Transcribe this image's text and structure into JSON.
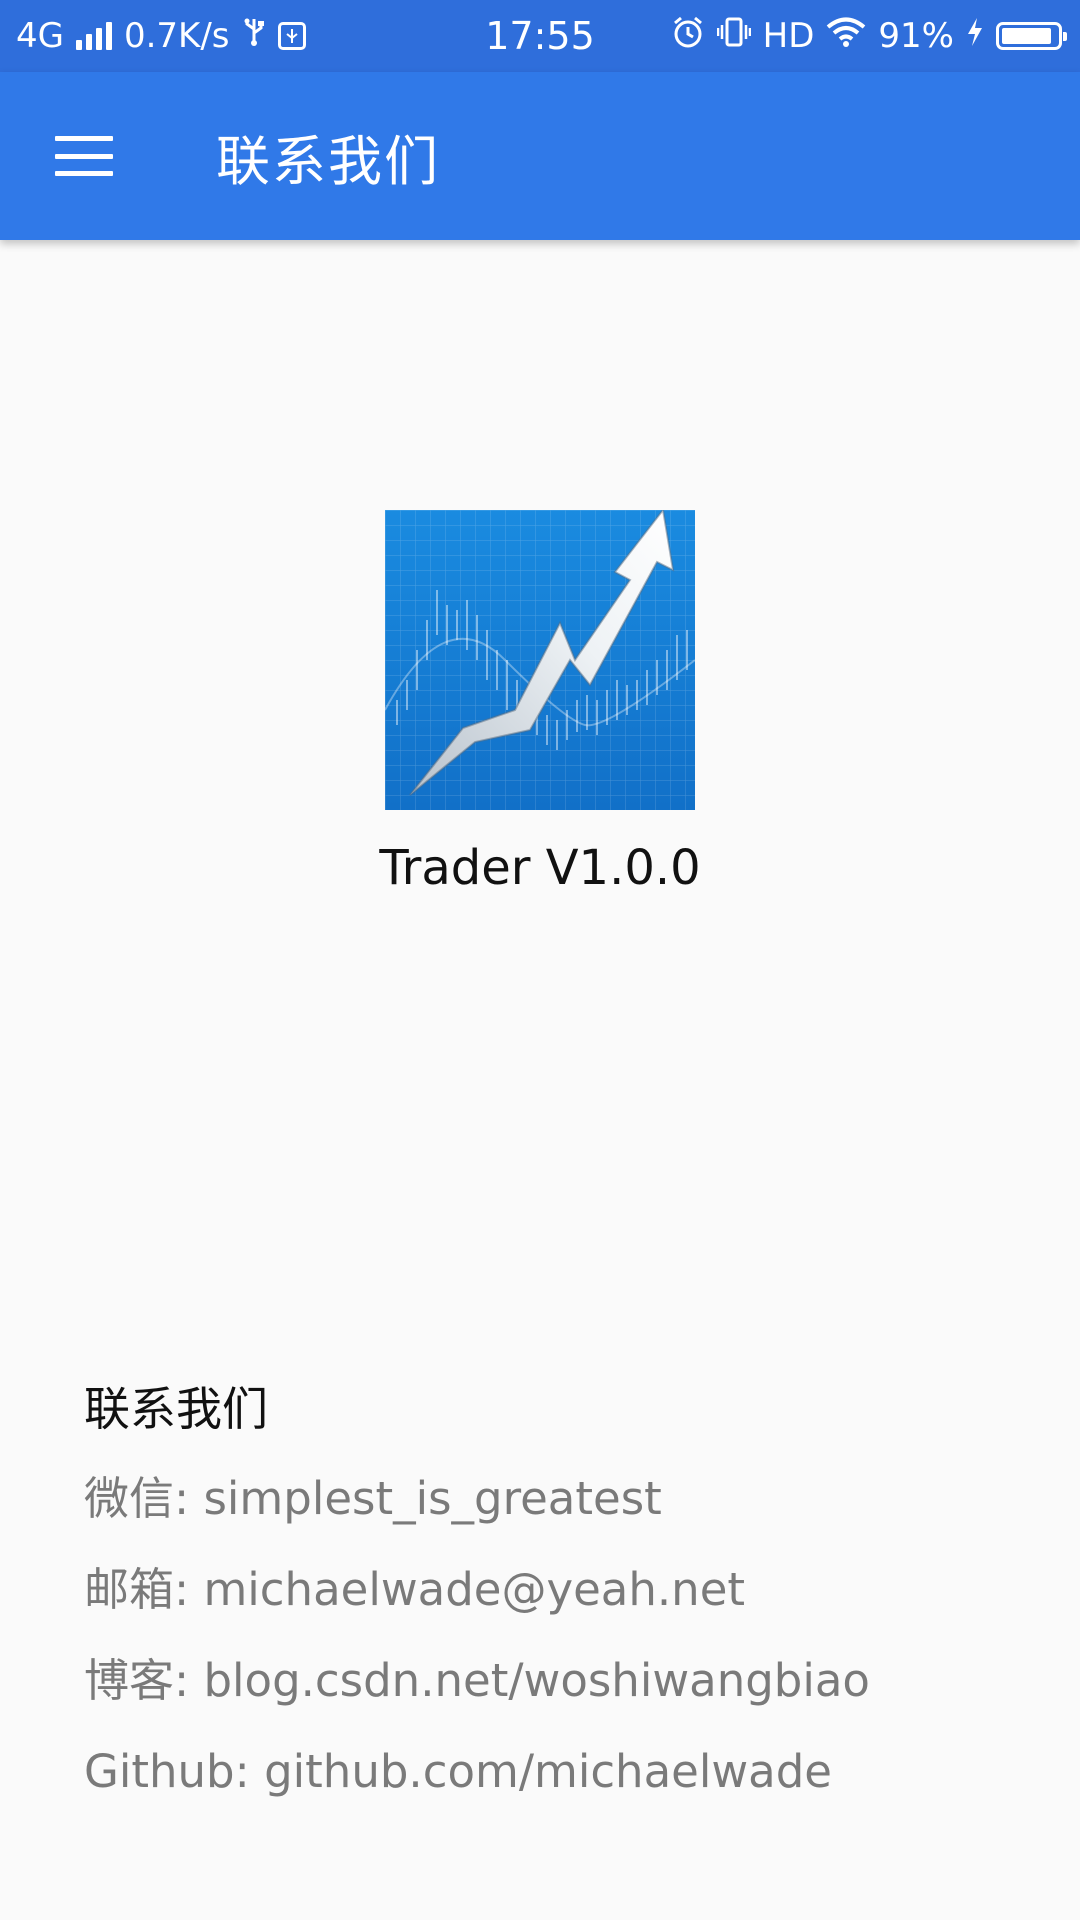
{
  "status_bar": {
    "network": "4G",
    "speed": "0.7K/s",
    "time": "17:55",
    "hd": "HD",
    "battery_percent": "91%",
    "battery_level": 0.91,
    "icons": [
      "signal-icon",
      "usb-icon",
      "usb-debug-icon",
      "alarm-icon",
      "vibrate-icon",
      "wifi-icon",
      "charging-icon",
      "battery-icon"
    ]
  },
  "app_bar": {
    "title": "联系我们",
    "menu_icon": "hamburger-menu-icon",
    "background": "#3079e8"
  },
  "app_info": {
    "icon": "trader-chart-arrow-icon",
    "version": "Trader V1.0.0"
  },
  "contact": {
    "heading": "联系我们",
    "wechat": "微信: simplest_is_greatest",
    "email": "邮箱: michaelwade@yeah.net",
    "blog": "博客: blog.csdn.net/woshiwangbiao",
    "github": "Github: github.com/michaelwade"
  }
}
